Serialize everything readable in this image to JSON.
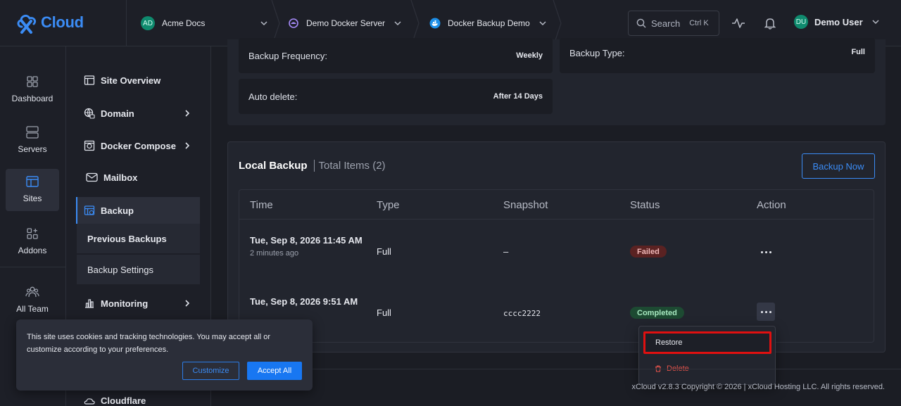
{
  "app": {
    "logo_text": "Cloud",
    "accent": "#3b8cf5"
  },
  "breadcrumbs": [
    {
      "label": "Acme Docs",
      "avatar": "AD"
    },
    {
      "label": "Demo Docker Server"
    },
    {
      "label": "Docker Backup Demo"
    }
  ],
  "search": {
    "label": "Search",
    "shortcut": "Ctrl K"
  },
  "user": {
    "initials": "DU",
    "name": "Demo User"
  },
  "rail": [
    {
      "label": "Dashboard",
      "icon": "dashboard-icon"
    },
    {
      "label": "Servers",
      "icon": "servers-icon"
    },
    {
      "label": "Sites",
      "icon": "sites-icon",
      "active": true
    },
    {
      "label": "Addons",
      "icon": "addons-icon"
    },
    {
      "label": "All Team",
      "icon": "team-icon"
    }
  ],
  "subnav": {
    "items": [
      {
        "label": "Site Overview"
      },
      {
        "label": "Domain"
      },
      {
        "label": "Docker Compose"
      },
      {
        "label": "Mailbox"
      },
      {
        "label": "Backup"
      },
      {
        "label": "Monitoring"
      },
      {
        "label": "Cloudflare"
      }
    ],
    "backup_children": [
      {
        "label": "Previous Backups"
      },
      {
        "label": "Backup Settings"
      }
    ]
  },
  "settings": {
    "frequency_label": "Backup Frequency:",
    "frequency_value": "Weekly",
    "type_label": "Backup Type:",
    "type_value": "Full",
    "autodelete_label": "Auto delete:",
    "autodelete_value": "After 14 Days"
  },
  "local_backup": {
    "title": "Local Backup",
    "total": "Total Items (2)",
    "backup_now": "Backup Now",
    "columns": [
      "Time",
      "Type",
      "Snapshot",
      "Status",
      "Action"
    ],
    "rows": [
      {
        "time": "Tue, Sep 8, 2026 11:45 AM",
        "ago": "2 minutes ago",
        "type": "Full",
        "snapshot": "–",
        "status": "Failed"
      },
      {
        "time": "Tue, Sep 8, 2026 9:51 AM",
        "type": "Full",
        "snapshot": "cccc2222",
        "status": "Completed"
      }
    ]
  },
  "action_menu": {
    "restore": "Restore",
    "delete": "Delete"
  },
  "cookie": {
    "text": "This site uses cookies and tracking technologies. You may accept all or customize according to your preferences.",
    "customize": "Customize",
    "accept": "Accept All"
  },
  "footer": {
    "text": "xCloud v2.8.3 Copyright © 2026 | xCloud Hosting LLC. All rights reserved."
  }
}
